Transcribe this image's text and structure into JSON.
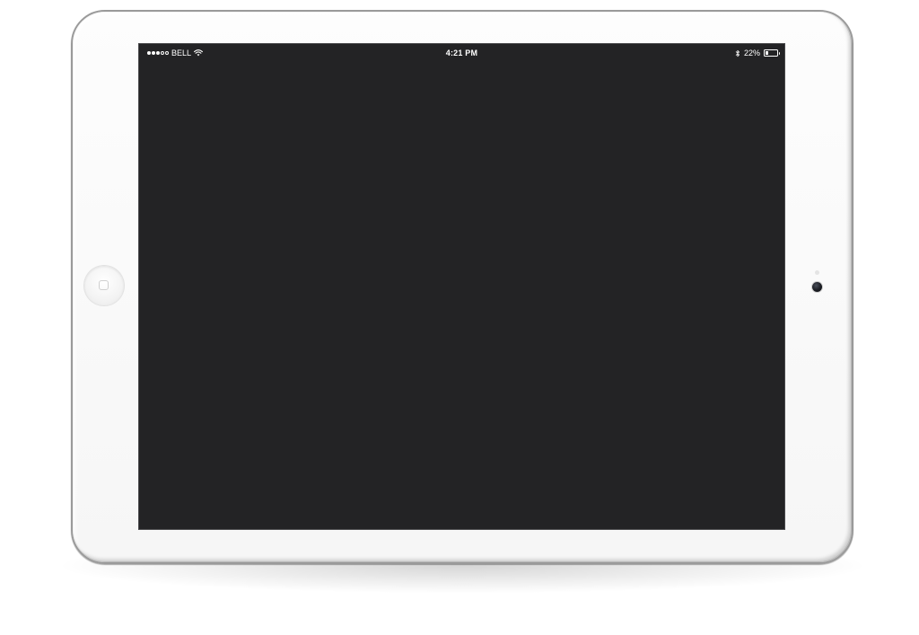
{
  "status_bar": {
    "signal_dots": {
      "filled": 3,
      "total": 5
    },
    "carrier": "BELL",
    "wifi_icon": "wifi-icon",
    "time": "4:21 PM",
    "bluetooth_icon": "bluetooth-icon",
    "battery_percent_text": "22%",
    "battery_level": 0.22
  },
  "colors": {
    "screen_background": "#232325",
    "device_body": "#f6f6f6",
    "status_text": "#ffffff"
  },
  "device": {
    "home_button_icon": "home-button-icon",
    "camera_icon": "front-camera-icon"
  }
}
